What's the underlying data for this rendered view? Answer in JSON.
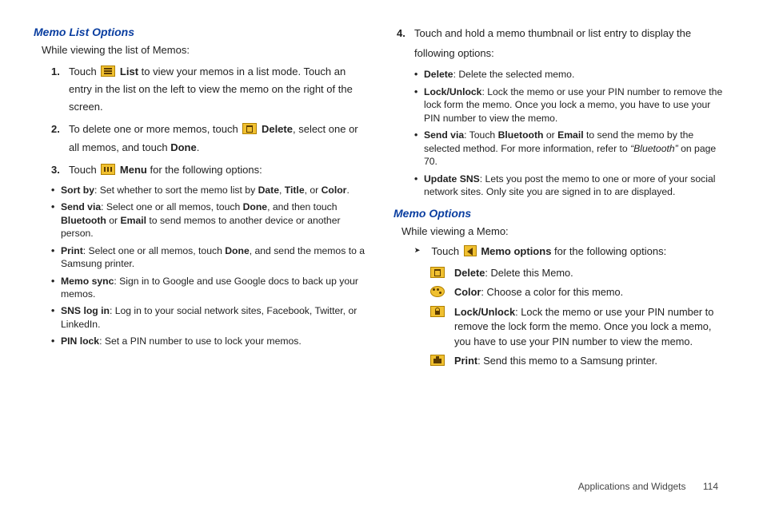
{
  "left": {
    "heading": "Memo List Options",
    "intro": "While viewing the list of Memos:",
    "step1_a": "Touch ",
    "step1_listLabel": " List",
    "step1_b": " to view your memos in a list mode. Touch an entry in the list on the left to view the memo on the right of the screen.",
    "step2_a": "To delete one or more memos, touch ",
    "step2_deleteLabel": " Delete",
    "step2_b": ", select one or all memos, and touch ",
    "step2_done": "Done",
    "step2_c": ".",
    "step3_a": "Touch ",
    "step3_menuLabel": " Menu",
    "step3_b": " for the following options:",
    "bul_sort_a": "Sort by",
    "bul_sort_b": ": Set whether to sort the memo list by ",
    "bul_sort_c": "Date",
    "bul_sort_d": ", ",
    "bul_sort_e": "Title",
    "bul_sort_f": ", or ",
    "bul_sort_g": "Color",
    "bul_sort_h": ".",
    "bul_send_a": "Send via",
    "bul_send_b": ": Select one or all memos, touch ",
    "bul_send_c": "Done",
    "bul_send_d": ", and then touch ",
    "bul_send_e": "Bluetooth",
    "bul_send_f": " or ",
    "bul_send_g": "Email",
    "bul_send_h": " to send memos to another device or another person.",
    "bul_print_a": "Print",
    "bul_print_b": ": Select one or all memos, touch ",
    "bul_print_c": "Done",
    "bul_print_d": ", and send the memos to a Samsung printer.",
    "bul_sync_a": "Memo sync",
    "bul_sync_b": ": Sign in to Google and use Google docs to back up your memos.",
    "bul_sns_a": "SNS log in",
    "bul_sns_b": ": Log in to your social network sites, Facebook, Twitter, or LinkedIn.",
    "bul_pin_a": "PIN lock",
    "bul_pin_b": ": Set a PIN number to use to lock your memos."
  },
  "right": {
    "step4_a": "Touch and hold a memo thumbnail or list entry to display the following options:",
    "b_del_a": "Delete",
    "b_del_b": ": Delete the selected memo.",
    "b_lock_a": "Lock/Unlock",
    "b_lock_b": ": Lock the memo or use your PIN number to remove the lock form the memo. Once you lock a memo, you have to use your PIN number to view the memo.",
    "b_sv_a": "Send via",
    "b_sv_b": ": Touch ",
    "b_sv_c": "Bluetooth",
    "b_sv_d": " or ",
    "b_sv_e": "Email",
    "b_sv_f": " to send the memo by the selected method. For more information, refer to ",
    "b_sv_g": "“Bluetooth” ",
    "b_sv_h": " on page 70.",
    "b_sns_a": "Update SNS",
    "b_sns_b": ": Lets you post the memo to one or more of your social network sites. Only site you are signed in to are displayed.",
    "heading2": "Memo Options",
    "intro2": "While viewing a Memo:",
    "touch_a": "Touch  ",
    "touch_b": " Memo options",
    "touch_c": " for the following options:",
    "opt_del_a": "Delete",
    "opt_del_b": ": Delete this Memo.",
    "opt_col_a": "Color",
    "opt_col_b": ": Choose a color for this memo.",
    "opt_lock_a": "Lock/Unlock",
    "opt_lock_b": ": Lock the memo or use your PIN number to remove the lock form the memo. Once you lock a memo, you have to use your PIN number to view the memo.",
    "opt_print_a": "Print",
    "opt_print_b": ": Send this memo to a Samsung printer."
  },
  "footer": {
    "section": "Applications and Widgets",
    "page": "114"
  }
}
